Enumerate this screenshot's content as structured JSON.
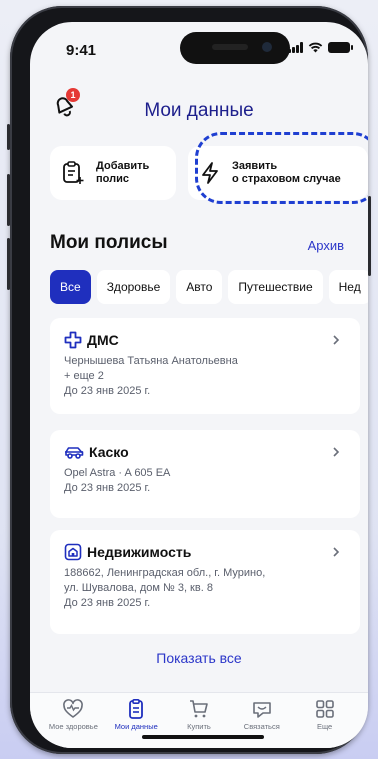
{
  "status": {
    "time": "9:41"
  },
  "header": {
    "title": "Мои данные",
    "notifications_count": "1"
  },
  "actions": [
    {
      "label": "Добавить\nполис",
      "icon": "add-document-icon"
    },
    {
      "label": "Заявить\nо страховом случае",
      "icon": "lightning-icon"
    }
  ],
  "policies": {
    "title": "Мои полисы",
    "archive_label": "Архив",
    "filters": [
      "Все",
      "Здоровье",
      "Авто",
      "Путешествие",
      "Нед"
    ],
    "active_filter": "Все",
    "items": [
      {
        "icon": "medical-cross-icon",
        "title": "ДМС",
        "lines": [
          "Чернышева Татьяна Анатольевна",
          "+ еще 2"
        ],
        "until": "До 23 янв 2025  г."
      },
      {
        "icon": "car-icon",
        "title": "Каско",
        "lines": [
          "Opel Astra · A 605 EA"
        ],
        "until": "До 23 янв 2025  г."
      },
      {
        "icon": "house-icon",
        "title": "Недвижимость",
        "lines": [
          "188662, Ленинградская обл., г. Мурино,",
          "ул. Шувалова, дом № 3, кв. 8"
        ],
        "until": "До 23 янв 2025  г."
      }
    ],
    "show_all_label": "Показать все"
  },
  "tabbar": {
    "items": [
      {
        "label": "Мое здоровье",
        "icon": "heart-icon",
        "active": false
      },
      {
        "label": "Мои данные",
        "icon": "clipboard-icon",
        "active": true
      },
      {
        "label": "Купить",
        "icon": "cart-icon",
        "active": false
      },
      {
        "label": "Связаться",
        "icon": "chat-icon",
        "active": false
      },
      {
        "label": "Еще",
        "icon": "grid-icon",
        "active": false
      }
    ]
  },
  "colors": {
    "accent": "#1f2fbe",
    "title": "#1d1f8c",
    "badge": "#e53935",
    "highlight_dash": "#1f3fd1"
  }
}
